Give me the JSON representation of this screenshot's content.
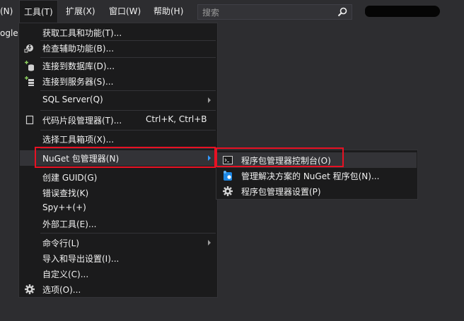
{
  "menubar": {
    "items": [
      {
        "label": "(N)"
      },
      {
        "label": "工具(T)"
      },
      {
        "label": "扩展(X)"
      },
      {
        "label": "窗口(W)"
      },
      {
        "label": "帮助(H)"
      }
    ],
    "search_placeholder": "搜索",
    "side_fragment": "ogle"
  },
  "tools_menu": {
    "items": [
      {
        "label": "获取工具和功能(T)...",
        "icon": "none"
      },
      {
        "label": "检查辅助功能(B)...",
        "icon": "accessibility-icon"
      },
      {
        "label": "连接到数据库(D)...",
        "icon": "database-add-icon"
      },
      {
        "label": "连接到服务器(S)...",
        "icon": "server-add-icon"
      },
      {
        "label": "SQL Server(Q)",
        "icon": "none",
        "submenu": true
      },
      {
        "label": "代码片段管理器(T)...",
        "shortcut": "Ctrl+K, Ctrl+B",
        "icon": "snippet-icon"
      },
      {
        "label": "选择工具箱项(X)...",
        "icon": "none"
      },
      {
        "label": "NuGet 包管理器(N)",
        "icon": "none",
        "submenu": true,
        "active": true
      },
      {
        "label": "创建 GUID(G)",
        "icon": "none"
      },
      {
        "label": "错误查找(K)",
        "icon": "none"
      },
      {
        "label": "Spy++(+)",
        "icon": "none"
      },
      {
        "label": "外部工具(E)...",
        "icon": "none"
      },
      {
        "label": "命令行(L)",
        "icon": "none",
        "submenu": true
      },
      {
        "label": "导入和导出设置(I)...",
        "icon": "none"
      },
      {
        "label": "自定义(C)...",
        "icon": "none"
      },
      {
        "label": "选项(O)...",
        "icon": "gear-icon"
      }
    ]
  },
  "nuget_submenu": {
    "items": [
      {
        "label": "程序包管理器控制台(O)",
        "icon": "console-icon",
        "active": true
      },
      {
        "label": "管理解决方案的 NuGet 程序包(N)...",
        "icon": "nuget-icon"
      },
      {
        "label": "程序包管理器设置(P)",
        "icon": "gear-icon"
      }
    ]
  },
  "colors": {
    "background": "#2d2d30",
    "menu_background": "#1b1b1c",
    "hover": "#333337",
    "highlight_border": "#e81123",
    "text": "#f1f1f1"
  }
}
